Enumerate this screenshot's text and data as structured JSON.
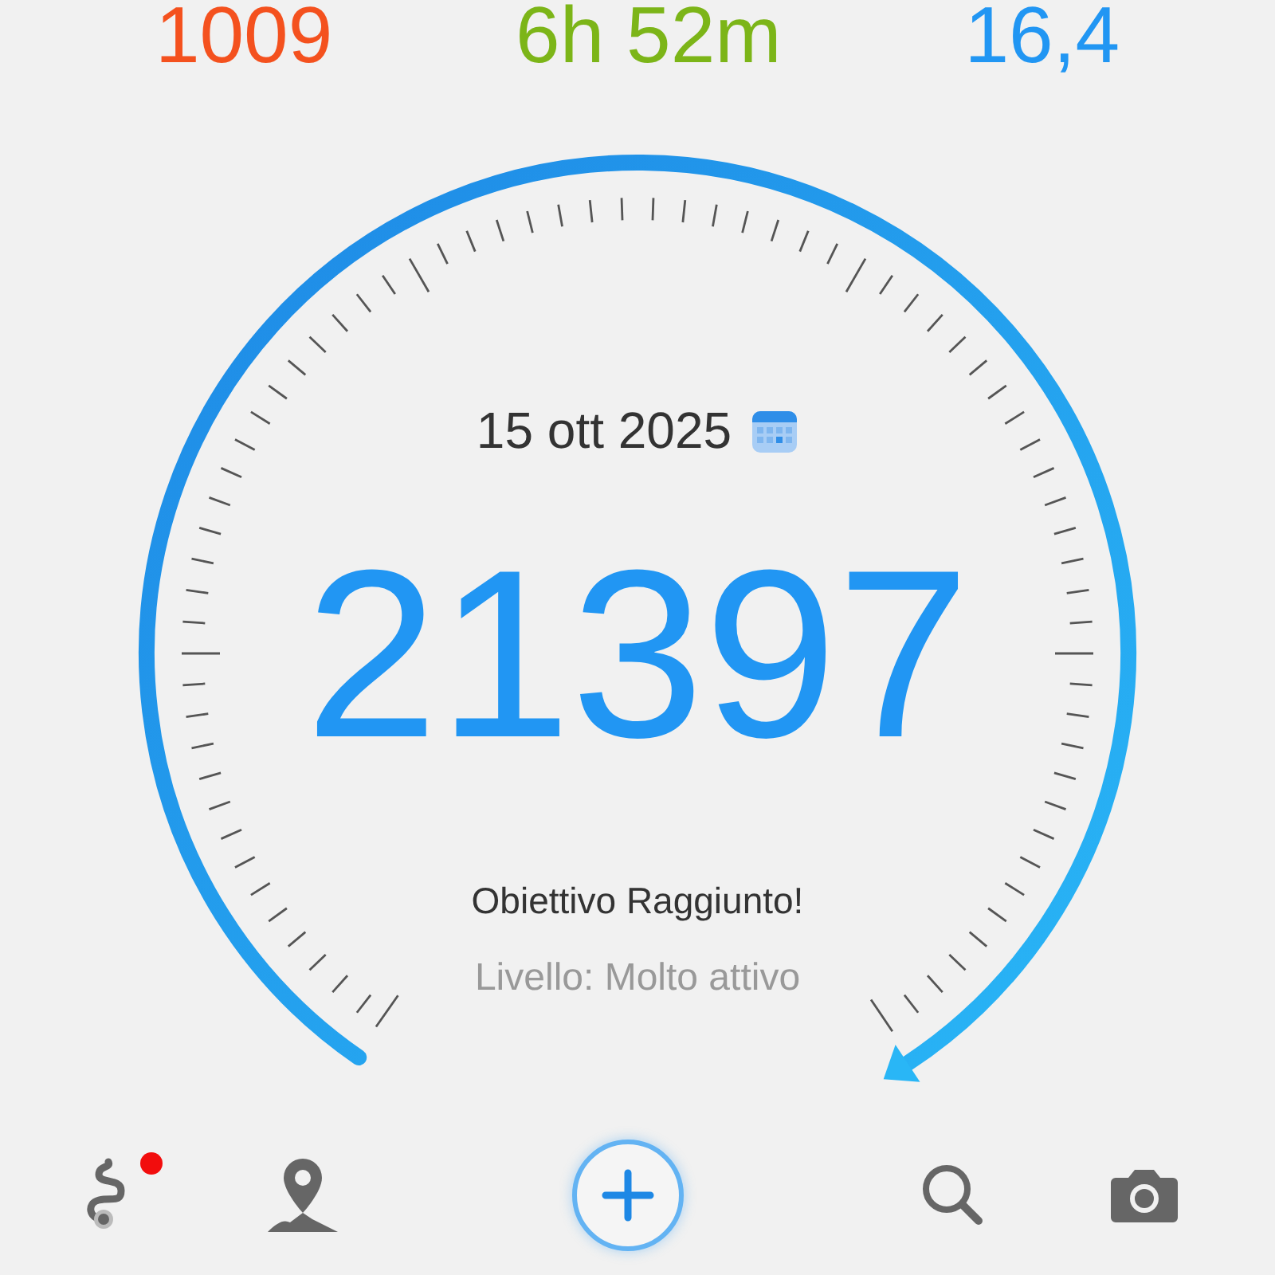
{
  "stats": [
    {
      "value": "1009",
      "color": "#f4511e"
    },
    {
      "value": "6h 52m",
      "color": "#7cb518"
    },
    {
      "value": "16,4",
      "color": "#2196f3"
    }
  ],
  "gauge": {
    "date": "15 ott 2025",
    "steps": "21397",
    "status": "Obiettivo Raggiunto!",
    "level_text": "Livello: Molto attivo"
  },
  "nav": [
    {
      "kind": "route",
      "badge": true
    },
    {
      "kind": "map-pin",
      "badge": false
    },
    {
      "kind": "add",
      "badge": false
    },
    {
      "kind": "search",
      "badge": false
    },
    {
      "kind": "camera",
      "badge": false
    }
  ]
}
